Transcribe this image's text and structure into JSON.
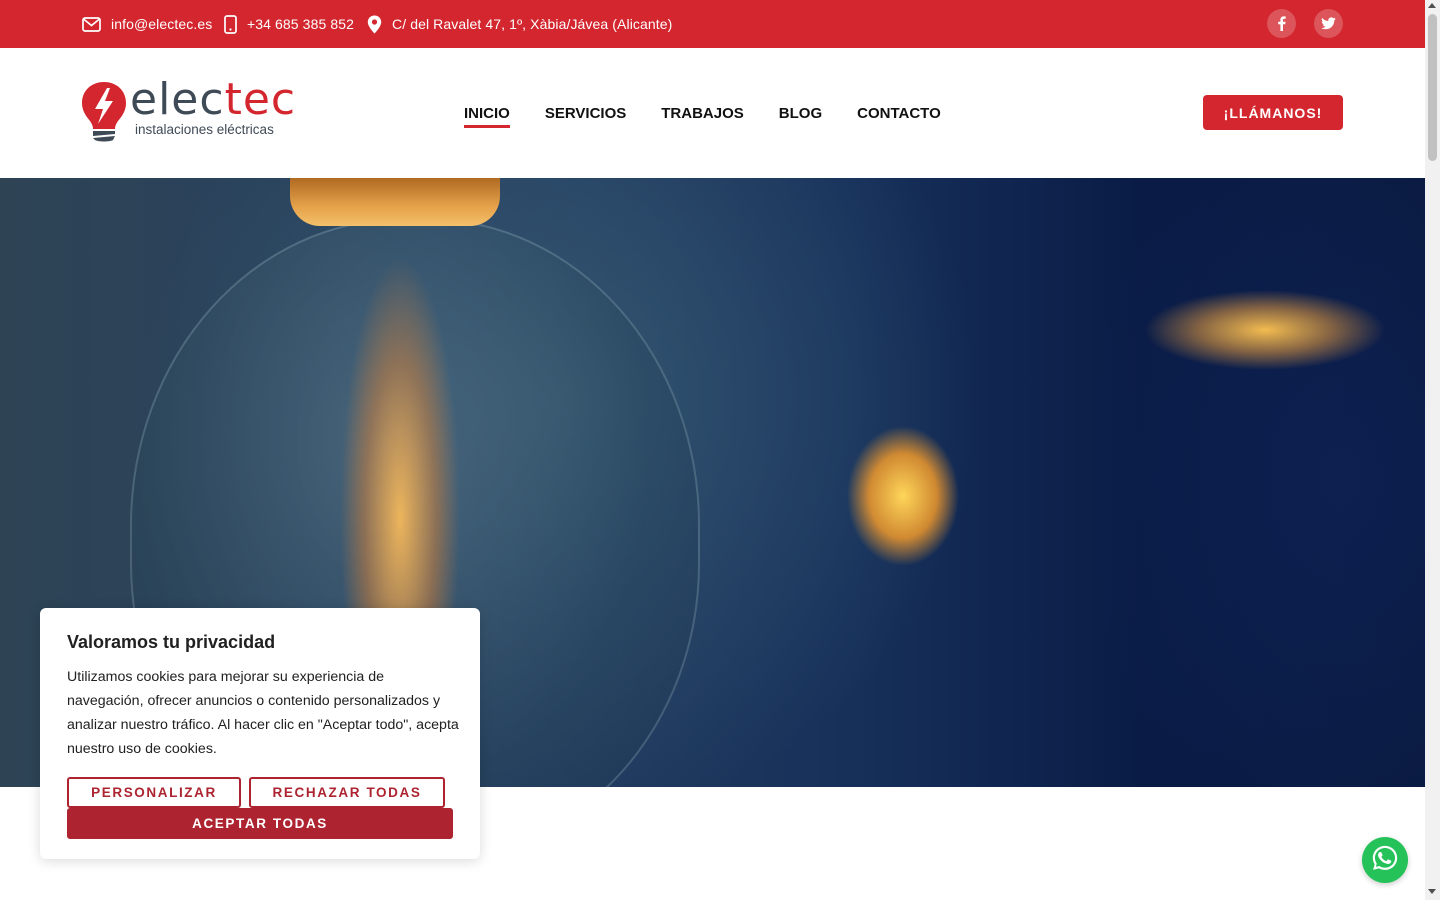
{
  "topbar": {
    "email": "info@electec.es",
    "phone": "+34 685 385 852",
    "address": "C/ del Ravalet 47, 1º, Xàbia/Jávea (Alicante)",
    "social": [
      "facebook-icon",
      "twitter-icon"
    ],
    "bg_color": "#d3262e"
  },
  "header": {
    "logo": {
      "word_start": "elec",
      "word_end": "tec",
      "tagline": "instalaciones eléctricas"
    },
    "nav": [
      {
        "label": "INICIO",
        "active": true
      },
      {
        "label": "SERVICIOS"
      },
      {
        "label": "TRABAJOS"
      },
      {
        "label": "BLOG"
      },
      {
        "label": "CONTACTO"
      }
    ],
    "call_button": "¡LLÁMANOS!"
  },
  "cookie": {
    "title": "Valoramos tu privacidad",
    "text": "Utilizamos cookies para mejorar su experiencia de navegación, ofrecer anuncios o contenido personalizados y analizar nuestro tráfico. Al hacer clic en \"Aceptar todo\", acepta nuestro uso de cookies.",
    "customize": "PERSONALIZAR",
    "reject": "RECHAZAR TODAS",
    "accept": "ACEPTAR TODAS",
    "accent_color": "#ad2430"
  },
  "whatsapp": {
    "icon": "whatsapp-icon",
    "color": "#25c25a"
  }
}
